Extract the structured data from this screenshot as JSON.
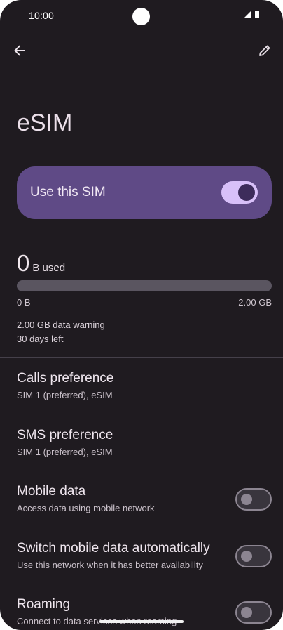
{
  "status_bar": {
    "time": "10:00",
    "icons": [
      "camera-cutout",
      "signal-icon",
      "battery-icon"
    ]
  },
  "top_bar": {
    "back_icon": "arrow-left-icon",
    "edit_icon": "pencil-icon"
  },
  "page": {
    "title": "eSIM"
  },
  "use_sim": {
    "label": "Use this SIM",
    "enabled": true
  },
  "usage": {
    "amount": "0",
    "unit": "B used",
    "fraction_used": 0,
    "min_label": "0 B",
    "max_label": "2.00 GB",
    "warning": "2.00 GB data warning",
    "days_left": "30 days left"
  },
  "preferences": [
    {
      "title": "Calls preference",
      "subtitle": "SIM 1 (preferred), eSIM"
    },
    {
      "title": "SMS preference",
      "subtitle": "SIM 1 (preferred), eSIM"
    }
  ],
  "toggles": [
    {
      "title": "Mobile data",
      "subtitle": "Access data using mobile network",
      "enabled": false
    },
    {
      "title": "Switch mobile data automatically",
      "subtitle": "Use this network when it has better availability",
      "enabled": false
    },
    {
      "title": "Roaming",
      "subtitle": "Connect to data services when roaming",
      "enabled": false
    }
  ],
  "colors": {
    "background": "#1f1b20",
    "accent_card": "#5f4a86",
    "toggle_on": "#d8c0f9",
    "toggle_off_outline": "#8c8591"
  }
}
